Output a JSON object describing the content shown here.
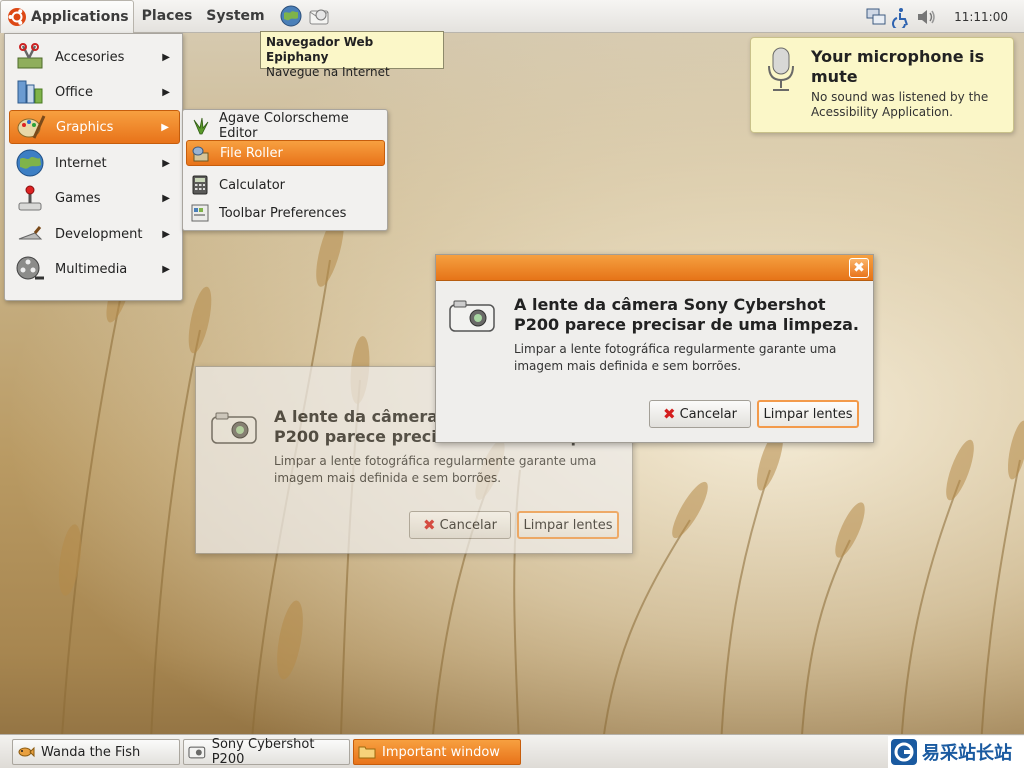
{
  "top_panel": {
    "menus": [
      "Applications",
      "Places",
      "System"
    ],
    "clock": "11:11:00"
  },
  "tooltip": {
    "title": "Navegador Web Epiphany",
    "subtitle": "Navegue na Internet"
  },
  "app_menu": {
    "items": [
      {
        "label": "Accesories",
        "icon": "accessories-icon"
      },
      {
        "label": "Office",
        "icon": "office-icon"
      },
      {
        "label": "Graphics",
        "icon": "graphics-icon",
        "selected": true
      },
      {
        "label": "Internet",
        "icon": "globe-icon"
      },
      {
        "label": "Games",
        "icon": "joystick-icon"
      },
      {
        "label": "Development",
        "icon": "trowel-icon"
      },
      {
        "label": "Multimedia",
        "icon": "film-reel-icon"
      }
    ]
  },
  "graphics_submenu": {
    "items": [
      {
        "label": "Agave Colorscheme Editor",
        "icon": "agave-icon"
      },
      {
        "label": "File Roller",
        "icon": "file-roller-icon",
        "selected": true
      },
      {
        "label": "Calculator",
        "icon": "calculator-icon"
      },
      {
        "label": "Toolbar Preferences",
        "icon": "toolbar-prefs-icon"
      }
    ]
  },
  "notification": {
    "title": "Your microphone is mute",
    "body": "No sound was listened by the Acessibility Application."
  },
  "dialog_front": {
    "title": "A lente da câmera Sony Cybershot P200 parece precisar de uma limpeza.",
    "body": "Limpar a lente fotográfica regularmente garante uma imagem mais definida e sem borrões.",
    "cancel_label": "Cancelar",
    "ok_label": "Limpar lentes",
    "close_glyph": "✖"
  },
  "dialog_back": {
    "title": "A lente da câmera Sony Cybershot P200 parece precisar de uma limpeza.",
    "body": "Limpar a lente fotográfica regularmente garante uma imagem mais definida e sem borrões.",
    "cancel_label": "Cancelar",
    "ok_label": "Limpar lentes"
  },
  "taskbar": {
    "tasks": [
      {
        "label": "Wanda the Fish",
        "icon": "fish-icon"
      },
      {
        "label": "Sony Cybershot P200",
        "icon": "camera-icon"
      },
      {
        "label": "Important window",
        "icon": "folder-icon",
        "active": true
      }
    ],
    "watermark_text": "易采站长站"
  },
  "colors": {
    "accent": "#e8731a",
    "panel": "#e4e2de",
    "tooltip": "#fbf7c8"
  }
}
